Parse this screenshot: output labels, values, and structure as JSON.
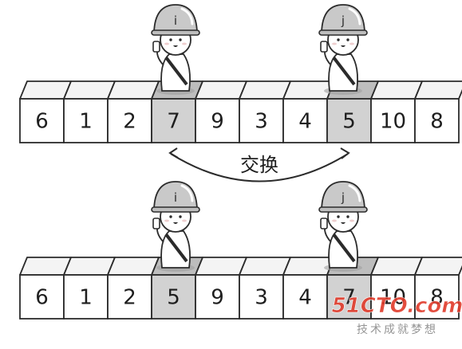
{
  "top_row": {
    "values": [
      "6",
      "1",
      "2",
      "7",
      "9",
      "3",
      "4",
      "5",
      "10",
      "8"
    ],
    "highlight_indices": [
      3,
      7
    ]
  },
  "bottom_row": {
    "values": [
      "6",
      "1",
      "2",
      "5",
      "9",
      "3",
      "4",
      "7",
      "10",
      "8"
    ],
    "highlight_indices": [
      3,
      7
    ]
  },
  "pointers": {
    "i": "i",
    "j": "j"
  },
  "swap_label": "交换",
  "watermark": {
    "logo": "51CTO.com",
    "tagline": "技术成就梦想"
  },
  "colors": {
    "cell_fill": "#ffffff",
    "highlight_fill": "#d2d2d2",
    "top_face": "#f4f4f4",
    "top_face_highlight": "#bdbdbd",
    "stroke": "#2b2b2b",
    "helmet": "#c9c9c9",
    "watermark_red": "#e03a2a",
    "watermark_gray": "#8a8a8a"
  }
}
